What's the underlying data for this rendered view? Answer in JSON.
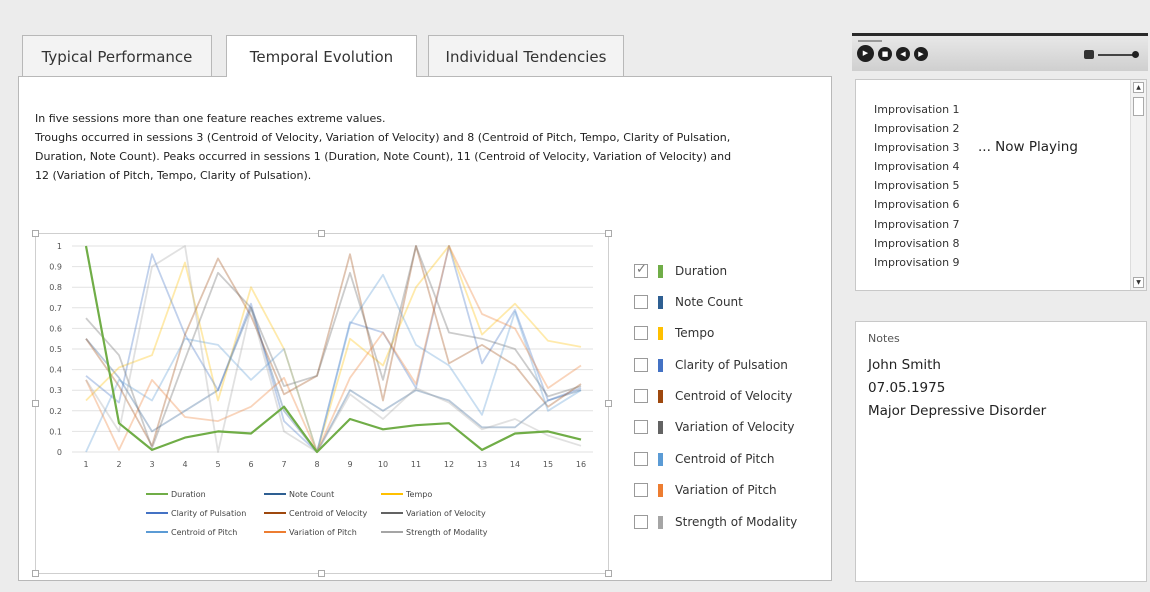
{
  "tabs": [
    {
      "label": "Typical Performance"
    },
    {
      "label": "Temporal Evolution"
    },
    {
      "label": "Individual Tendencies"
    }
  ],
  "active_tab": "Temporal Evolution",
  "description": [
    "In five sessions more than one feature reaches extreme values.",
    "Troughs occurred in sessions 3 (Centroid of Velocity, Variation of Velocity) and 8 (Centroid of Pitch, Tempo, Clarity of Pulsation,",
    "Duration, Note Count). Peaks occurred in sessions 1 (Duration, Note Count), 11 (Centroid of Velocity, Variation of Velocity) and",
    "12 (Variation of Pitch, Tempo, Clarity of Pulsation)."
  ],
  "feature_list": [
    {
      "label": "Duration",
      "checked": true,
      "color": "#70ad47"
    },
    {
      "label": "Note Count",
      "checked": false,
      "color": "#2e5f92"
    },
    {
      "label": "Tempo",
      "checked": false,
      "color": "#ffc000"
    },
    {
      "label": "Clarity of Pulsation",
      "checked": false,
      "color": "#4472c4"
    },
    {
      "label": "Centroid of Velocity",
      "checked": false,
      "color": "#9e480e"
    },
    {
      "label": "Variation of Velocity",
      "checked": false,
      "color": "#636363"
    },
    {
      "label": "Centroid of Pitch",
      "checked": false,
      "color": "#5b9bd5"
    },
    {
      "label": "Variation of Pitch",
      "checked": false,
      "color": "#ed7d31"
    },
    {
      "label": "Strength of Modality",
      "checked": false,
      "color": "#a5a5a5"
    }
  ],
  "playlist": {
    "items": [
      "Improvisation 1",
      "Improvisation 2",
      "Improvisation 3",
      "Improvisation 4",
      "Improvisation 5",
      "Improvisation 6",
      "Improvisation 7",
      "Improvisation 8",
      "Improvisation 9"
    ],
    "now_playing_label": "... Now Playing",
    "now_playing_index": 2
  },
  "player": {
    "controls": [
      "play-icon",
      "stop-icon",
      "previous-icon",
      "next-icon"
    ],
    "volume_icon": "speaker-icon"
  },
  "notes": {
    "title": "Notes",
    "lines": [
      "John Smith",
      "07.05.1975",
      "Major Depressive Disorder"
    ]
  },
  "chart_data": {
    "type": "line",
    "x": [
      1,
      2,
      3,
      4,
      5,
      6,
      7,
      8,
      9,
      10,
      11,
      12,
      13,
      14,
      15,
      16
    ],
    "ylim": [
      0,
      1
    ],
    "yticks": [
      "0",
      "0.1",
      "0.2",
      "0.3",
      "0.4",
      "0.5",
      "0.6",
      "0.7",
      "0.8",
      "0.9",
      "1"
    ],
    "grid": true,
    "legend_position": "bottom",
    "series": [
      {
        "name": "Duration",
        "color": "#70ad47",
        "highlight": true,
        "values": [
          1.0,
          0.14,
          0.01,
          0.07,
          0.1,
          0.09,
          0.22,
          0.0,
          0.16,
          0.11,
          0.13,
          0.14,
          0.01,
          0.09,
          0.1,
          0.06
        ]
      },
      {
        "name": "Note Count",
        "color": "#2e5f92",
        "highlight": false,
        "values": [
          0.55,
          0.36,
          0.1,
          0.2,
          0.3,
          0.7,
          0.2,
          0.0,
          0.3,
          0.2,
          0.3,
          0.25,
          0.12,
          0.12,
          0.25,
          0.3
        ]
      },
      {
        "name": "Tempo",
        "color": "#ffc000",
        "highlight": false,
        "values": [
          0.25,
          0.41,
          0.47,
          0.92,
          0.25,
          0.8,
          0.5,
          0.0,
          0.55,
          0.42,
          0.8,
          1.0,
          0.57,
          0.72,
          0.54,
          0.51
        ]
      },
      {
        "name": "Clarity of Pulsation",
        "color": "#4472c4",
        "highlight": false,
        "values": [
          0.37,
          0.24,
          0.96,
          0.57,
          0.3,
          0.72,
          0.15,
          0.0,
          0.63,
          0.58,
          0.31,
          1.0,
          0.43,
          0.69,
          0.25,
          0.31
        ]
      },
      {
        "name": "Centroid of Velocity",
        "color": "#9e480e",
        "highlight": false,
        "values": [
          0.55,
          0.32,
          0.03,
          0.57,
          0.94,
          0.66,
          0.28,
          0.37,
          0.96,
          0.25,
          1.0,
          0.43,
          0.52,
          0.42,
          0.22,
          0.33
        ]
      },
      {
        "name": "Variation of Velocity",
        "color": "#636363",
        "highlight": false,
        "values": [
          0.65,
          0.47,
          0.02,
          0.45,
          0.87,
          0.7,
          0.32,
          0.37,
          0.87,
          0.35,
          1.0,
          0.58,
          0.55,
          0.5,
          0.27,
          0.32
        ]
      },
      {
        "name": "Centroid of Pitch",
        "color": "#5b9bd5",
        "highlight": false,
        "values": [
          0.0,
          0.35,
          0.25,
          0.55,
          0.52,
          0.35,
          0.5,
          0.0,
          0.62,
          0.86,
          0.52,
          0.42,
          0.18,
          0.68,
          0.2,
          0.3
        ]
      },
      {
        "name": "Variation of Pitch",
        "color": "#ed7d31",
        "highlight": false,
        "values": [
          0.35,
          0.01,
          0.35,
          0.17,
          0.15,
          0.22,
          0.36,
          0.0,
          0.36,
          0.58,
          0.33,
          1.0,
          0.67,
          0.6,
          0.31,
          0.42
        ]
      },
      {
        "name": "Strength of Modality",
        "color": "#a5a5a5",
        "highlight": false,
        "values": [
          0.35,
          0.1,
          0.9,
          1.0,
          0.0,
          0.7,
          0.1,
          0.0,
          0.28,
          0.16,
          0.31,
          0.24,
          0.11,
          0.16,
          0.08,
          0.03
        ]
      }
    ]
  }
}
